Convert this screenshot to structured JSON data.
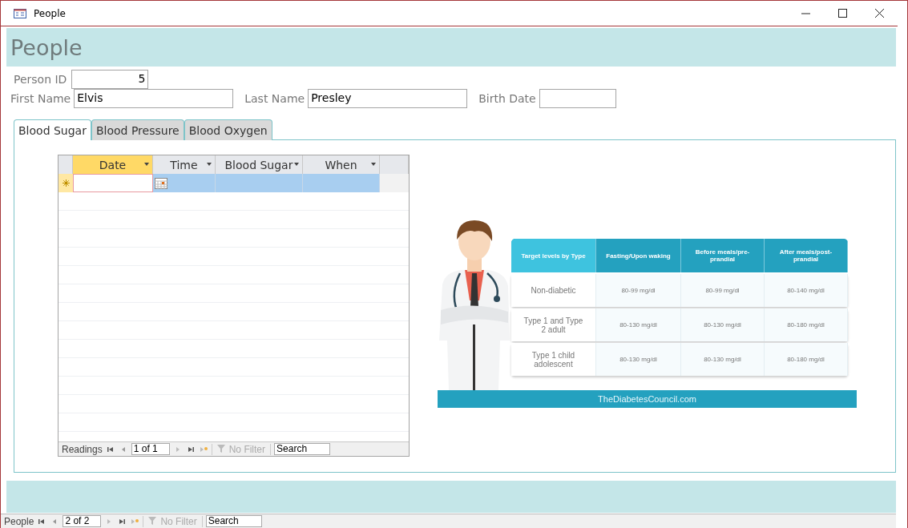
{
  "window": {
    "title": "People"
  },
  "header": {
    "title": "People"
  },
  "person_id": {
    "label": "Person ID",
    "value": "5"
  },
  "fields": [
    {
      "label": "First Name",
      "value": "Elvis"
    },
    {
      "label": "Last Name",
      "value": "Presley"
    },
    {
      "label": "Birth Date"
    }
  ],
  "tabs": [
    {
      "label": "Blood Sugar",
      "selected": true
    },
    {
      "label": "Blood Pressure",
      "selected": false
    },
    {
      "label": "Blood Oxygen",
      "selected": false
    }
  ],
  "datasheet": {
    "columns": [
      {
        "label": "Date",
        "selected": true
      },
      {
        "label": "Time",
        "selected": false
      },
      {
        "label": "Blood Sugar",
        "selected": false
      },
      {
        "label": "When",
        "selected": false
      }
    ],
    "navigator": {
      "label": "Readings",
      "record": "1 of 1",
      "filter": "No Filter",
      "search": "Search"
    }
  },
  "infographic": {
    "header": [
      "Target levels by Type",
      "Fasting/Upon waking",
      "Before meals/pre-prandial",
      "After meals/post-prandial"
    ],
    "rows": [
      [
        "Non-diabetic",
        "80-99 mg/dl",
        "80-99 mg/dl",
        "80-140 mg/dl"
      ],
      [
        "Type 1 and Type 2 adult",
        "80-130 mg/dl",
        "80-130 mg/dl",
        "80-180 mg/dl"
      ],
      [
        "Type 1 child adolescent",
        "80-130 mg/dl",
        "80-130 mg/dl",
        "80-180 mg/dl"
      ]
    ],
    "footer": "TheDiabetesCouncil.com"
  },
  "form_navigator": {
    "label": "People",
    "record": "2 of 2",
    "filter": "No Filter",
    "search": "Search"
  }
}
